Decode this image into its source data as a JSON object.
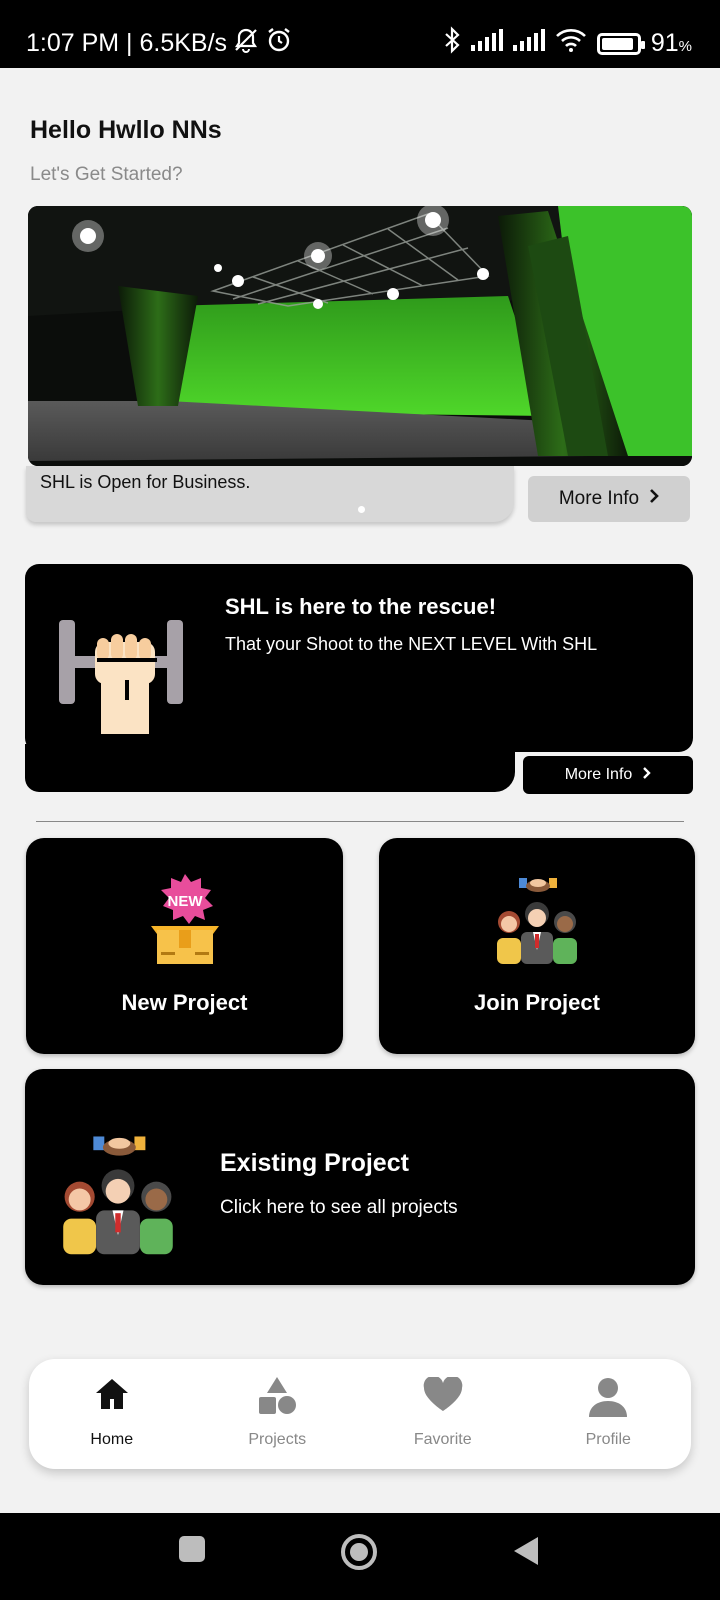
{
  "status_bar": {
    "time_info": "1:07 PM | 6.5KB/s",
    "battery_pct": "91",
    "battery_level": 0.91,
    "icons": [
      "bell-off-icon",
      "alarm-icon",
      "bluetooth-icon",
      "signal-icon",
      "signal-icon",
      "wifi-icon",
      "battery-icon"
    ]
  },
  "greeting": {
    "title": "Hello Hwllo NNs",
    "subtitle": "Let's Get Started?"
  },
  "hero": {
    "caption": "SHL is Open for Business.",
    "more_label": "More Info",
    "image": "green-screen-studio"
  },
  "rescue_card": {
    "title": "SHL is here to the rescue!",
    "subtitle": "That your Shoot to the NEXT LEVEL With SHL",
    "more_label": "More Info",
    "icon": "fist-dumbbell-icon"
  },
  "tiles": {
    "new_project": {
      "label": "New Project",
      "icon": "new-box-icon",
      "badge": "NEW"
    },
    "join_project": {
      "label": "Join Project",
      "icon": "team-handshake-icon"
    },
    "existing_project": {
      "title": "Existing Project",
      "subtitle": "Click here to see all projects",
      "icon": "team-handshake-icon"
    }
  },
  "bottom_nav": {
    "items": [
      {
        "label": "Home",
        "icon": "home-icon",
        "active": true
      },
      {
        "label": "Projects",
        "icon": "shapes-icon",
        "active": false
      },
      {
        "label": "Favorite",
        "icon": "heart-icon",
        "active": false
      },
      {
        "label": "Profile",
        "icon": "person-icon",
        "active": false
      }
    ]
  },
  "colors": {
    "background": "#f2f2f2",
    "card": "#000000",
    "accent_green": "#3fbf1f",
    "nav_active": "#111111",
    "nav_inactive": "#888888"
  }
}
